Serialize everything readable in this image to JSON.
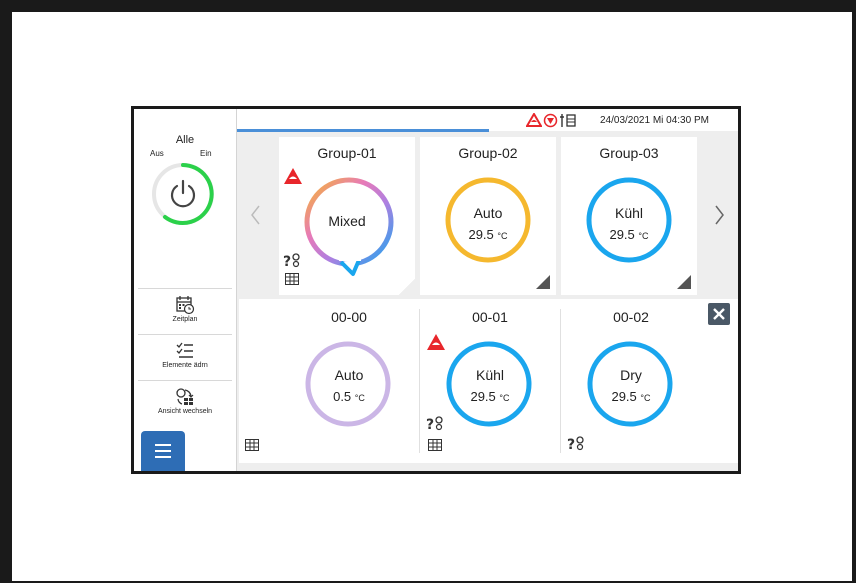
{
  "sidebar": {
    "power": {
      "title": "Alle",
      "off_label": "Aus",
      "on_label": "Ein"
    },
    "items": [
      {
        "label": "Zeitplan",
        "icon": "calendar-clock-icon"
      },
      {
        "label": "Elemente ädrn",
        "icon": "checklist-icon"
      },
      {
        "label": "Ansicht wechseln",
        "icon": "switch-view-icon"
      }
    ],
    "menu_icon": "hamburger-icon"
  },
  "topbar": {
    "datetime": "24/03/2021 Mi 04:30 PM",
    "status_icons": [
      "alarm-warning-icon",
      "service-icon",
      "maintenance-icon"
    ]
  },
  "groups": [
    {
      "name": "Group-01",
      "mode": "Mixed",
      "temp": "",
      "unit": "",
      "ring": "gradient"
    },
    {
      "name": "Group-02",
      "mode": "Auto",
      "temp": "29.5",
      "unit": "°C",
      "ring": "#f5b82e"
    },
    {
      "name": "Group-03",
      "mode": "Kühl",
      "temp": "29.5",
      "unit": "°C",
      "ring": "#1aa6ee"
    }
  ],
  "units": [
    {
      "name": "00-00",
      "mode": "Auto",
      "temp": "0.5",
      "unit": "°C",
      "ring": "#cbb6e6"
    },
    {
      "name": "00-01",
      "mode": "Kühl",
      "temp": "29.5",
      "unit": "°C",
      "ring": "#1aa6ee"
    },
    {
      "name": "00-02",
      "mode": "Dry",
      "temp": "29.5",
      "unit": "°C",
      "ring": "#1aa6ee"
    }
  ],
  "colors": {
    "accent": "#2e6db5",
    "alarm": "#e8262b",
    "power_on": "#2bd14a"
  }
}
